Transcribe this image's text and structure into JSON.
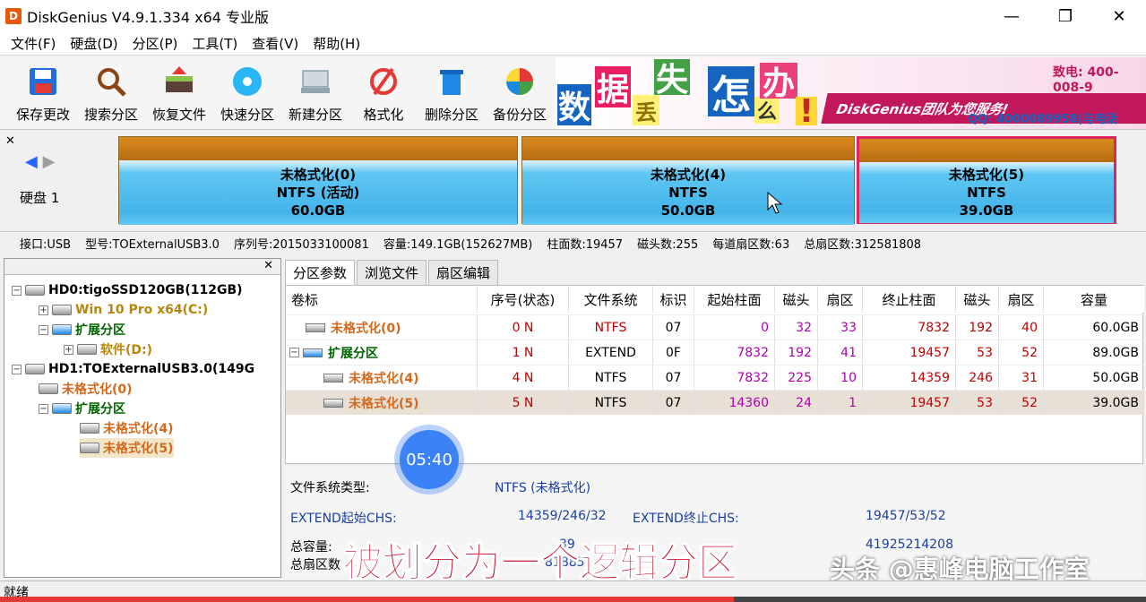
{
  "window": {
    "title": "DiskGenius V4.9.1.334 x64 专业版",
    "min_icon": "minimize-icon",
    "max_icon": "restore-icon",
    "close_icon": "close-icon"
  },
  "menu": [
    "文件(F)",
    "硬盘(D)",
    "分区(P)",
    "工具(T)",
    "查看(V)",
    "帮助(H)"
  ],
  "toolbar": [
    {
      "label": "保存更改",
      "icon": "save-icon"
    },
    {
      "label": "搜索分区",
      "icon": "search-icon"
    },
    {
      "label": "恢复文件",
      "icon": "recover-icon"
    },
    {
      "label": "快速分区",
      "icon": "quick-partition-icon"
    },
    {
      "label": "新建分区",
      "icon": "new-partition-icon"
    },
    {
      "label": "格式化",
      "icon": "format-icon"
    },
    {
      "label": "删除分区",
      "icon": "delete-icon"
    },
    {
      "label": "备份分区",
      "icon": "backup-icon"
    }
  ],
  "banner": {
    "chars": [
      "数",
      "据",
      "丢",
      "失",
      "怎",
      "么",
      "办",
      "!"
    ],
    "slogan": "DiskGenius团队为您服务!",
    "phone": "致电: 400-008-9",
    "qq": "QQ: 4000089958(与电话"
  },
  "diskmap": {
    "disk_label": "硬盘 1",
    "partitions": [
      {
        "name": "未格式化(0)",
        "fs": "NTFS (活动)",
        "size": "60.0GB"
      },
      {
        "name": "未格式化(4)",
        "fs": "NTFS",
        "size": "50.0GB"
      },
      {
        "name": "未格式化(5)",
        "fs": "NTFS",
        "size": "39.0GB"
      }
    ]
  },
  "diskinfo": {
    "interface": "接口:USB",
    "model": "型号:TOExternalUSB3.0",
    "serial": "序列号:2015033100081",
    "capacity": "容量:149.1GB(152627MB)",
    "cylinders": "柱面数:19457",
    "heads": "磁头数:255",
    "sectors_per_track": "每道扇区数:63",
    "total_sectors": "总扇区数:312581808"
  },
  "tree": [
    {
      "label": "HD0:tigoSSD120GB(112GB)",
      "color": "#000000"
    },
    {
      "label": "Win 10 Pro x64(C:)",
      "color": "#b8860b"
    },
    {
      "label": "扩展分区",
      "color": "#006400"
    },
    {
      "label": "软件(D:)",
      "color": "#b8860b"
    },
    {
      "label": "HD1:TOExternalUSB3.0(149G",
      "color": "#000000"
    },
    {
      "label": "未格式化(0)",
      "color": "#d2691e"
    },
    {
      "label": "扩展分区",
      "color": "#006400"
    },
    {
      "label": "未格式化(4)",
      "color": "#d2691e"
    },
    {
      "label": "未格式化(5)",
      "color": "#d2691e"
    }
  ],
  "tabs": [
    "分区参数",
    "浏览文件",
    "扇区编辑"
  ],
  "grid": {
    "headers": [
      "卷标",
      "序号(状态)",
      "文件系统",
      "标识",
      "起始柱面",
      "磁头",
      "扇区",
      "终止柱面",
      "磁头",
      "扇区",
      "容量"
    ],
    "rows": [
      [
        "未格式化(0)",
        "0 N",
        "NTFS",
        "07",
        "0",
        "32",
        "33",
        "7832",
        "192",
        "40",
        "60.0GB"
      ],
      [
        "扩展分区",
        "1 N",
        "EXTEND",
        "0F",
        "7832",
        "192",
        "41",
        "19457",
        "53",
        "52",
        "89.0GB"
      ],
      [
        "未格式化(4)",
        "4 N",
        "NTFS",
        "07",
        "7832",
        "225",
        "10",
        "14359",
        "246",
        "31",
        "50.0GB"
      ],
      [
        "未格式化(5)",
        "5 N",
        "NTFS",
        "07",
        "14360",
        "24",
        "1",
        "19457",
        "53",
        "52",
        "39.0GB"
      ]
    ]
  },
  "details": {
    "fs_type_label": "文件系统类型:",
    "fs_type_value": "NTFS (未格式化)",
    "ext_start_label": "EXTEND起始CHS:",
    "ext_start_value": "14359/246/32",
    "ext_end_label": "EXTEND终止CHS:",
    "ext_end_value": "19457/53/52",
    "total_cap_label": "总容量:",
    "total_cap_value": "39",
    "total_cap_value2": "41925214208",
    "total_sec_label": "总扇区数",
    "total_sec_value": "81885"
  },
  "overlay": {
    "timer": "05:40",
    "subtitle": "被划分为一个逻辑分区",
    "watermark": "头条 @惠峰电脑工作室"
  },
  "status": "就绪",
  "video_progress": 0.64
}
